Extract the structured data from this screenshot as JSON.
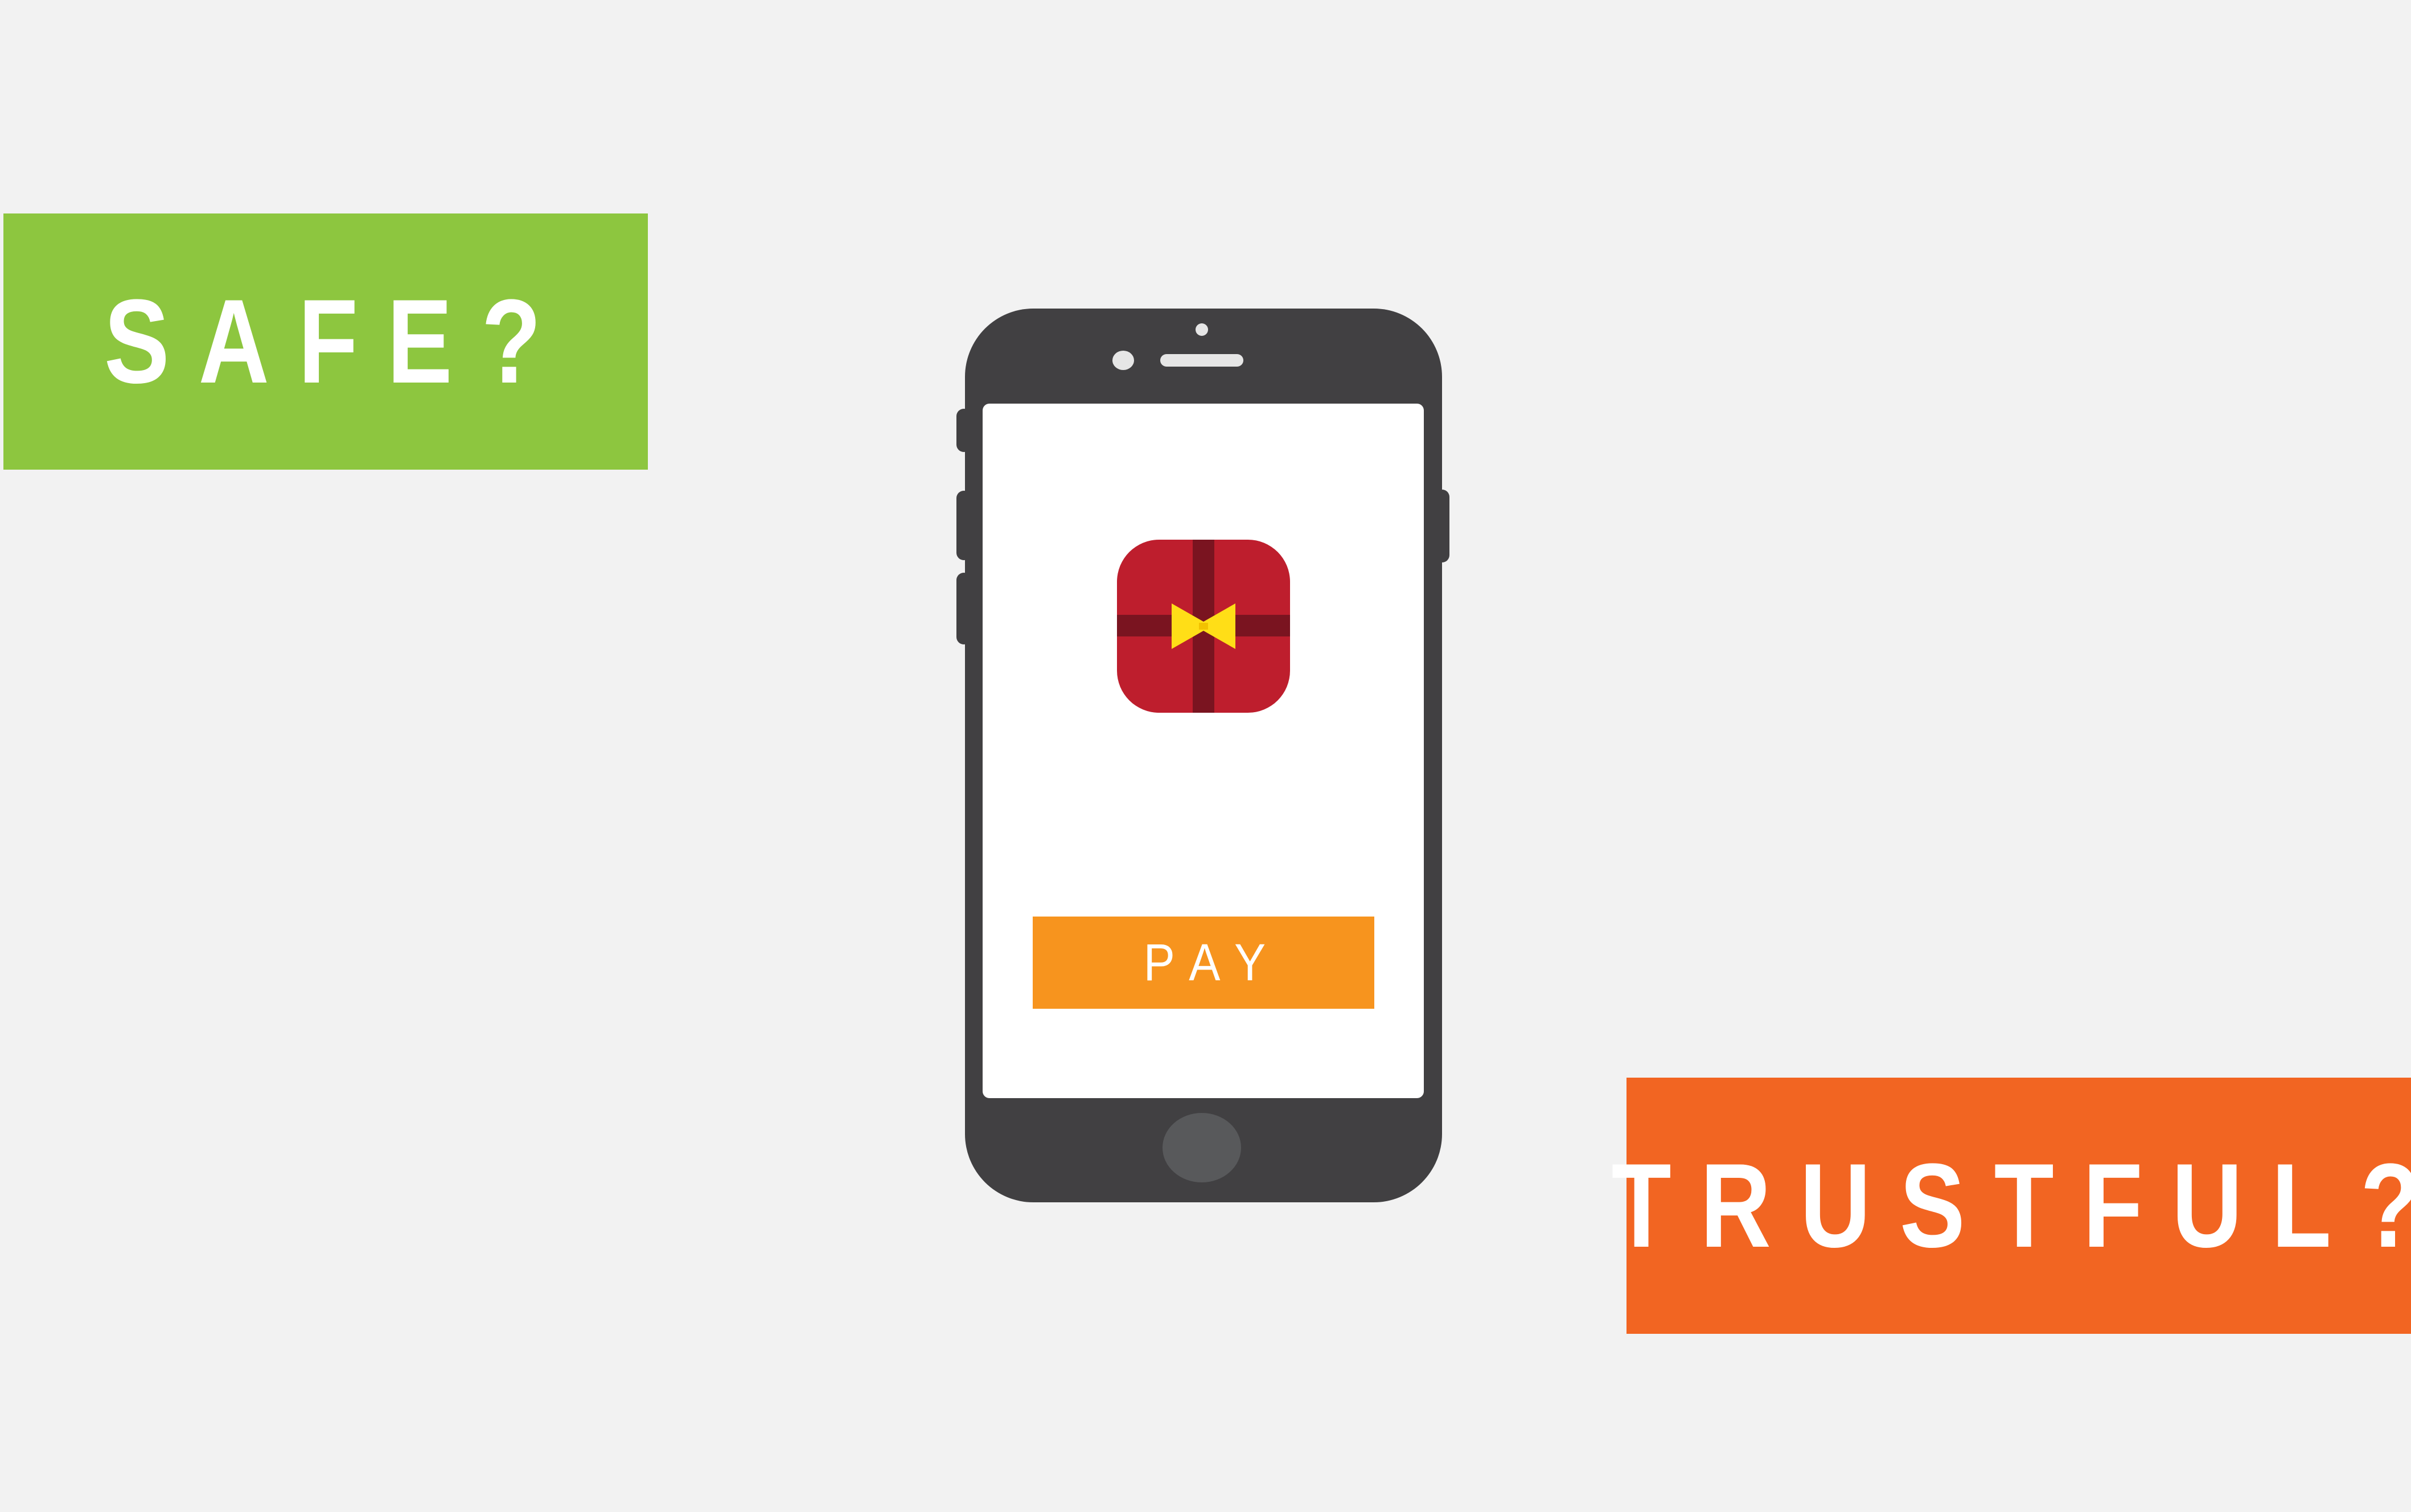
{
  "labels": {
    "safe": {
      "text": "SAFE?",
      "color": "#8dc63f"
    },
    "trustful": {
      "text": "TRUSTFUL?",
      "color": "#f26522"
    }
  },
  "phone": {
    "body_color": "#414042",
    "screen_color": "#ffffff",
    "app_icon": {
      "icon": "gift-icon",
      "box_color": "#be1e2d",
      "ribbon_color": "#7a1420",
      "bow_color": "#ffde17"
    },
    "pay_button": {
      "label": "PAY",
      "color": "#f7941e"
    }
  },
  "background_color": "#f2f2f2"
}
